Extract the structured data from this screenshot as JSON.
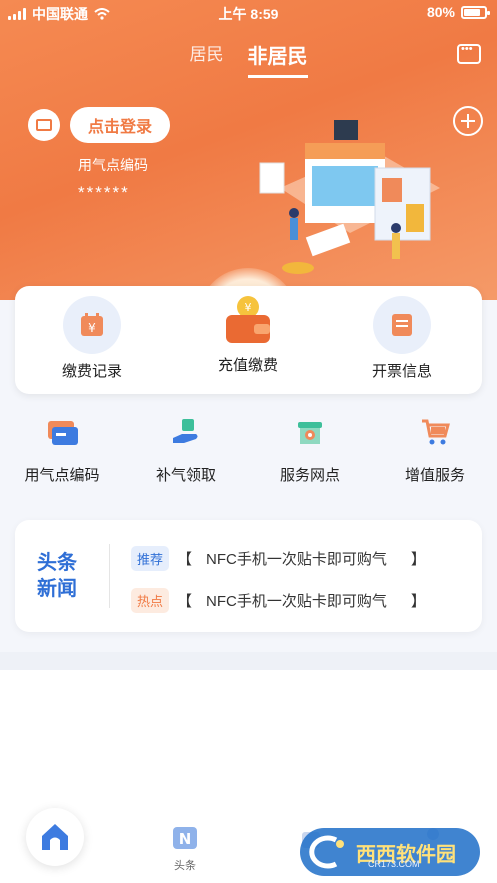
{
  "status": {
    "carrier": "中国联通",
    "time": "上午 8:59",
    "battery": "80%",
    "battery_level": 0.8
  },
  "tabs": [
    {
      "label": "居民"
    },
    {
      "label": "非居民"
    }
  ],
  "header": {
    "login_label": "点击登录",
    "code_label": "用气点编码",
    "code_value": "******"
  },
  "card": {
    "items": [
      {
        "label": "缴费记录",
        "icon": "calendar-yen-icon"
      },
      {
        "label": "充值缴费",
        "icon": "wallet-coin-icon"
      },
      {
        "label": "开票信息",
        "icon": "invoice-icon"
      }
    ]
  },
  "grid": {
    "items": [
      {
        "label": "用气点编码",
        "icon": "card-icon"
      },
      {
        "label": "补气领取",
        "icon": "hand-gift-icon"
      },
      {
        "label": "服务网点",
        "icon": "store-location-icon"
      },
      {
        "label": "增值服务",
        "icon": "cart-icon"
      }
    ]
  },
  "news": {
    "logo_line1": "头条",
    "logo_line2": "新闻",
    "rows": [
      {
        "tag": "推荐",
        "open": "【",
        "text": "NFC手机一次贴卡即可购气",
        "close": "】"
      },
      {
        "tag": "热点",
        "open": "【",
        "text": "NFC手机一次贴卡即可购气",
        "close": "】"
      }
    ]
  },
  "tabbar": {
    "items": [
      {
        "label": "头条",
        "icon": "news-n-icon"
      }
    ]
  },
  "watermark": {
    "title": "西西软件园",
    "sub": "CR173.COM"
  },
  "colors": {
    "accent": "#f07a44",
    "blue": "#2f6fd6"
  }
}
